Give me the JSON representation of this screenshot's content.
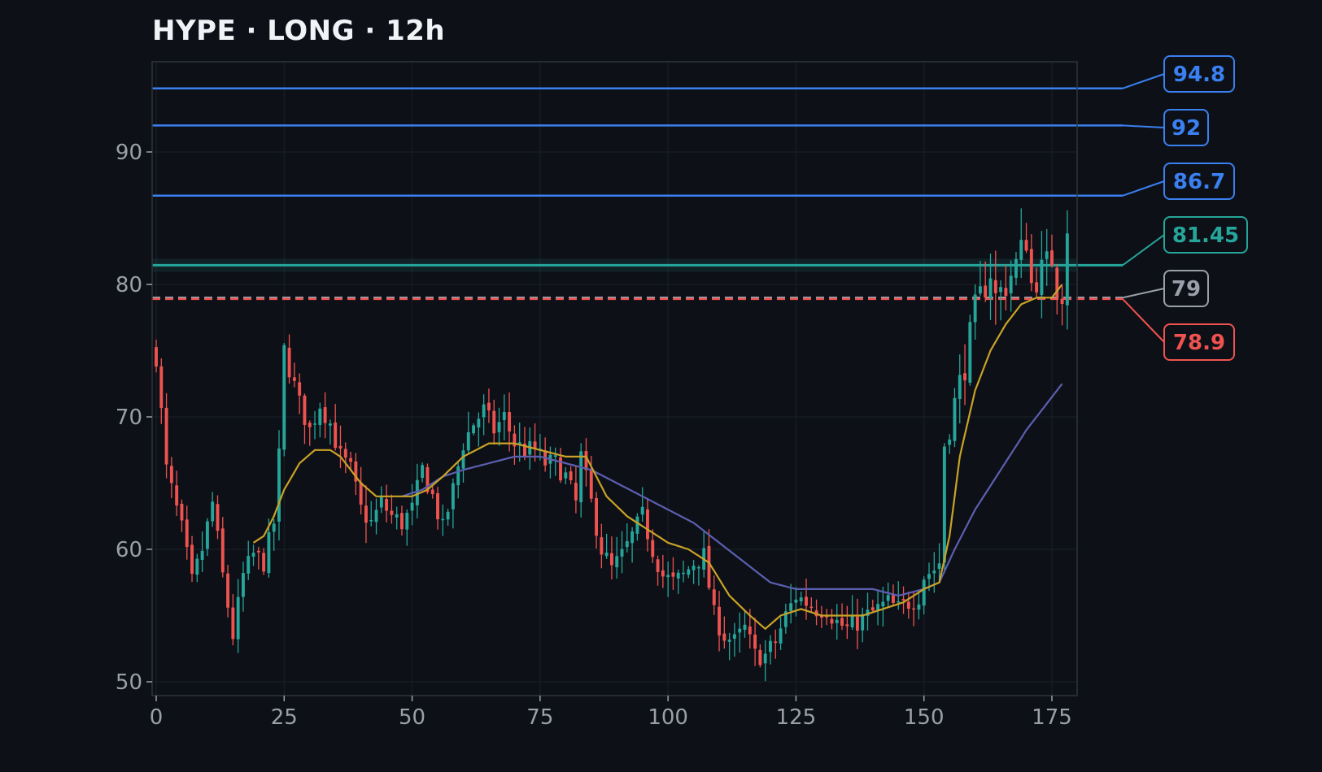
{
  "title": "HYPE · LONG · 12h",
  "chart_data": {
    "type": "candlestick",
    "title": "HYPE · LONG · 12h",
    "xlim": [
      0,
      179
    ],
    "ylim": [
      49,
      97
    ],
    "x_ticks": [
      0,
      25,
      50,
      75,
      100,
      125,
      150,
      175
    ],
    "y_ticks": [
      50,
      60,
      70,
      80,
      90
    ],
    "grid": true,
    "colors": {
      "up": "#26a69a",
      "down": "#ef5350",
      "ma_fast": "#c9a227",
      "ma_slow": "#5c5fb0",
      "background": "#0d1017"
    },
    "close_anchors": [
      [
        0,
        74.6
      ],
      [
        2,
        66
      ],
      [
        5,
        61.5
      ],
      [
        7,
        57.5
      ],
      [
        9,
        60
      ],
      [
        11,
        63.5
      ],
      [
        13,
        58
      ],
      [
        15,
        53.5
      ],
      [
        17,
        58
      ],
      [
        19,
        59.6
      ],
      [
        21,
        59
      ],
      [
        23,
        62
      ],
      [
        24,
        67
      ],
      [
        25,
        75
      ],
      [
        28,
        71
      ],
      [
        30,
        69
      ],
      [
        32,
        71
      ],
      [
        34,
        69.5
      ],
      [
        36,
        67
      ],
      [
        38,
        66
      ],
      [
        40,
        63
      ],
      [
        42,
        62
      ],
      [
        44,
        63.5
      ],
      [
        46,
        62.5
      ],
      [
        48,
        62
      ],
      [
        50,
        63
      ],
      [
        52,
        66
      ],
      [
        54,
        64
      ],
      [
        56,
        61.5
      ],
      [
        58,
        64.5
      ],
      [
        60,
        68
      ],
      [
        62,
        69.5
      ],
      [
        64,
        70.5
      ],
      [
        66,
        69
      ],
      [
        68,
        70
      ],
      [
        70,
        68
      ],
      [
        72,
        67.5
      ],
      [
        74,
        67.5
      ],
      [
        76,
        66.5
      ],
      [
        78,
        66.5
      ],
      [
        80,
        65.5
      ],
      [
        82,
        63.5
      ],
      [
        83,
        67
      ],
      [
        85,
        63.5
      ],
      [
        87,
        60
      ],
      [
        89,
        58.5
      ],
      [
        91,
        59.5
      ],
      [
        93,
        61
      ],
      [
        95,
        62.5
      ],
      [
        97,
        60
      ],
      [
        99,
        58
      ],
      [
        101,
        57.5
      ],
      [
        103,
        58
      ],
      [
        105,
        59
      ],
      [
        107,
        59.5
      ],
      [
        109,
        55
      ],
      [
        111,
        53.5
      ],
      [
        113,
        53
      ],
      [
        115,
        54
      ],
      [
        117,
        52
      ],
      [
        119,
        52
      ],
      [
        121,
        53
      ],
      [
        123,
        55
      ],
      [
        125,
        56.5
      ],
      [
        127,
        56
      ],
      [
        129,
        55.5
      ],
      [
        131,
        55.5
      ],
      [
        133,
        54.5
      ],
      [
        135,
        54
      ],
      [
        137,
        54.5
      ],
      [
        139,
        55
      ],
      [
        141,
        55.5
      ],
      [
        143,
        56
      ],
      [
        145,
        55.5
      ],
      [
        147,
        56
      ],
      [
        149,
        56.5
      ],
      [
        150,
        58
      ],
      [
        152,
        58.5
      ],
      [
        153,
        59
      ],
      [
        154,
        68
      ],
      [
        156,
        71
      ],
      [
        158,
        74
      ],
      [
        160,
        78
      ],
      [
        162,
        80
      ],
      [
        163,
        81
      ],
      [
        164,
        79
      ],
      [
        166,
        80
      ],
      [
        168,
        81.5
      ],
      [
        170,
        83.5
      ],
      [
        171,
        80
      ],
      [
        173,
        81
      ],
      [
        175,
        82
      ],
      [
        176,
        80
      ],
      [
        177,
        79.5
      ],
      [
        178,
        84.5
      ]
    ],
    "ma_fast_anchors": [
      [
        19,
        60.5
      ],
      [
        21,
        61
      ],
      [
        23,
        62.5
      ],
      [
        25,
        64.5
      ],
      [
        28,
        66.5
      ],
      [
        31,
        67.5
      ],
      [
        34,
        67.5
      ],
      [
        36,
        67
      ],
      [
        38,
        66
      ],
      [
        40,
        65
      ],
      [
        43,
        64
      ],
      [
        47,
        64
      ],
      [
        50,
        64
      ],
      [
        53,
        64.5
      ],
      [
        56,
        65.5
      ],
      [
        60,
        67
      ],
      [
        65,
        68
      ],
      [
        70,
        68
      ],
      [
        75,
        67.5
      ],
      [
        80,
        67
      ],
      [
        84,
        67
      ],
      [
        88,
        64
      ],
      [
        92,
        62.5
      ],
      [
        96,
        61.5
      ],
      [
        100,
        60.5
      ],
      [
        104,
        60
      ],
      [
        108,
        59
      ],
      [
        112,
        56.5
      ],
      [
        116,
        55
      ],
      [
        119,
        54
      ],
      [
        122,
        55
      ],
      [
        126,
        55.5
      ],
      [
        130,
        55
      ],
      [
        134,
        55
      ],
      [
        138,
        55
      ],
      [
        142,
        55.5
      ],
      [
        146,
        56
      ],
      [
        150,
        57
      ],
      [
        153,
        57.5
      ],
      [
        155,
        61
      ],
      [
        157,
        67
      ],
      [
        160,
        72
      ],
      [
        163,
        75
      ],
      [
        166,
        77
      ],
      [
        169,
        78.5
      ],
      [
        172,
        79
      ],
      [
        175,
        79
      ],
      [
        177,
        80
      ]
    ],
    "ma_slow_anchors": [
      [
        48,
        64
      ],
      [
        52,
        64.5
      ],
      [
        56,
        65.5
      ],
      [
        60,
        66
      ],
      [
        65,
        66.5
      ],
      [
        70,
        67
      ],
      [
        75,
        67
      ],
      [
        80,
        66.5
      ],
      [
        85,
        66
      ],
      [
        90,
        65
      ],
      [
        95,
        64
      ],
      [
        100,
        63
      ],
      [
        105,
        62
      ],
      [
        110,
        60.5
      ],
      [
        115,
        59
      ],
      [
        120,
        57.5
      ],
      [
        125,
        57
      ],
      [
        130,
        57
      ],
      [
        135,
        57
      ],
      [
        140,
        57
      ],
      [
        145,
        56.5
      ],
      [
        150,
        57
      ],
      [
        153,
        57.5
      ],
      [
        156,
        60
      ],
      [
        160,
        63
      ],
      [
        165,
        66
      ],
      [
        170,
        69
      ],
      [
        175,
        71.5
      ],
      [
        177,
        72.5
      ]
    ],
    "levels": [
      {
        "value": 94.8,
        "label": "94.8",
        "color": "#3a80f0",
        "style": "solid"
      },
      {
        "value": 92,
        "label": "92",
        "color": "#3a80f0",
        "style": "solid"
      },
      {
        "value": 86.7,
        "label": "86.7",
        "color": "#3a80f0",
        "style": "solid"
      },
      {
        "value": 81.45,
        "label": "81.45",
        "color": "#26a69a",
        "style": "zone"
      },
      {
        "value": 79,
        "label": "79",
        "color": "#9aa0aa",
        "style": "dashed"
      },
      {
        "value": 78.9,
        "label": "78.9",
        "color": "#ef5350",
        "style": "dashed"
      }
    ]
  }
}
